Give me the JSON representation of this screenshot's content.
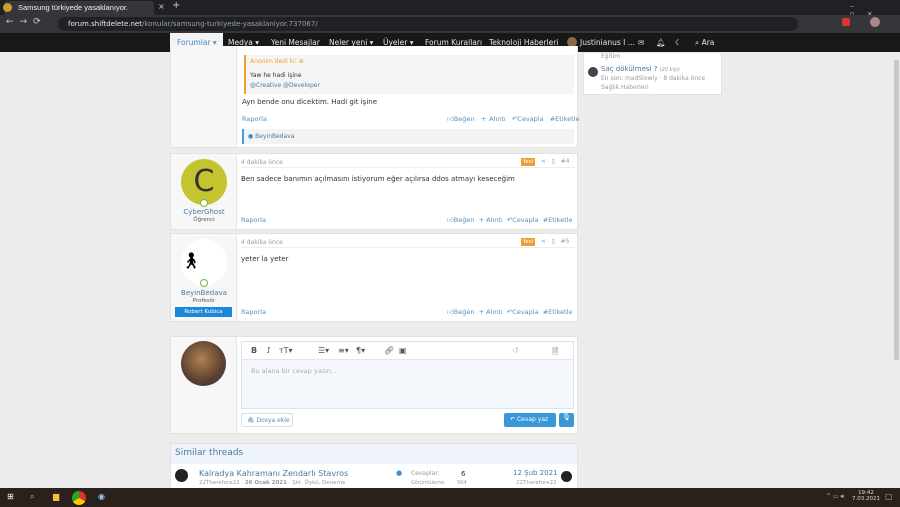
{
  "browser": {
    "tab_title": "Samsung türkiyede yasaklanıyor.",
    "url_domain": "forum.shiftdelete.net",
    "url_path": "/konular/samsung-turkiyede-yasaklaniyor.737067/"
  },
  "nav": {
    "items": [
      "Forumlar",
      "Medya",
      "Yeni Mesajlar",
      "Neler yeni",
      "Üyeler",
      "Forum Kuralları",
      "Teknoloji Haberleri",
      "Justinianus I ...",
      "Ara"
    ]
  },
  "sidebar": {
    "prev_category": "Eğitim",
    "thread_title": "Saç dökülmesi ?",
    "thread_age": "(20 kişi)",
    "last": "En son: madSlowly · 8 dakika önce",
    "category": "Sağlık Haberleri"
  },
  "post3": {
    "quote_author": "Anonim dedi ki:",
    "quote_text": "Yaw he hadi işine",
    "quote_mentions": "@Creative @Developer",
    "body": "Ayn bende onu dicektim. Hadi git işine",
    "like_user": "BeyinBedava"
  },
  "actions": {
    "report": "Raporla",
    "like": "Beğen",
    "quote": "+ Alıntı",
    "reply": "Cevapla",
    "tag": "#Etiketle"
  },
  "post4": {
    "time": "4 dakika önce",
    "badge": "Yeni",
    "number": "#4",
    "body": "Ben sadece banımın açılmasını istiyorum eğer açılırsa ddos atmayı keseceğim",
    "user": "CyberGhost",
    "role": "Öğrenci",
    "avatar_letter": "C"
  },
  "post5": {
    "time": "4 dakika önce",
    "badge": "Yeni",
    "number": "#5",
    "body": "yeter la yeter",
    "user": "BeyinBedava",
    "role": "Profesör",
    "banner": "Robert Kubica"
  },
  "editor": {
    "placeholder": "Bu alana bir cevap yazın...",
    "attach": "Dosya ekle",
    "submit": "Cevap yaz"
  },
  "similar": {
    "heading": "Similar threads",
    "title": "Kalradya Kahramanı Zendarlı Stavros",
    "author": "22Therefore22",
    "date": "26 Ocak 2021",
    "forum": "Şiir, Öykü, Deneme",
    "replies_label": "Cevaplar:",
    "replies": "6",
    "views_label": "Görüntüleme:",
    "views": "504",
    "last_date": "12 Şub 2021",
    "last_user": "22Therefore22"
  },
  "taskbar": {
    "time": "19:42",
    "date": "7.03.2021"
  }
}
